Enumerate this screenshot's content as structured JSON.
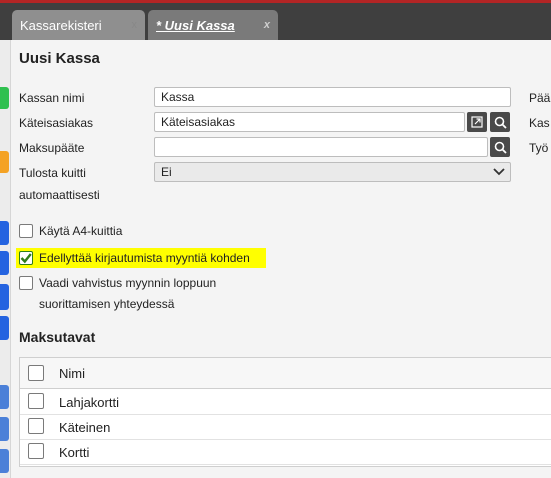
{
  "tabs": [
    {
      "label": "Kassarekisteri",
      "close": "x"
    },
    {
      "label": "* Uusi Kassa",
      "close": "x"
    }
  ],
  "form": {
    "title": "Uusi Kassa",
    "fields": {
      "kassan_nimi": {
        "label": "Kassan nimi",
        "value": "Kassa"
      },
      "kateisasiakas": {
        "label": "Käteisasiakas",
        "value": "Käteisasiakas"
      },
      "maksupaate": {
        "label": "Maksupääte",
        "value": ""
      },
      "tulosta_kuitti": {
        "label_line1": "Tulosta kuitti",
        "label_line2": "automaattisesti",
        "value": "Ei"
      }
    },
    "right_labels": [
      "Pää",
      "Kas",
      "Työ"
    ]
  },
  "checkboxes": [
    {
      "label": "Käytä A4-kuittia",
      "checked": false
    },
    {
      "label": "Edellyttää kirjautumista myyntiä kohden",
      "checked": true,
      "highlight_color": "#ffff00"
    },
    {
      "label_line1": "Vaadi vahvistus myynnin loppuun",
      "label_line2": "suorittamisen yhteydessä",
      "checked": false
    }
  ],
  "payment": {
    "section_title": "Maksutavat",
    "column": "Nimi",
    "rows": [
      "Lahjakortti",
      "Käteinen",
      "Kortti"
    ]
  },
  "icons": {
    "search": "search-icon",
    "open_link": "open-link-icon",
    "chevron": "chevron-down-icon",
    "checkmark": "checkmark-icon"
  },
  "colors": {
    "topbar": "#3f3f3f",
    "accent_red": "#b32525",
    "highlight": "#ffff00",
    "check": "#2f7d1a"
  }
}
